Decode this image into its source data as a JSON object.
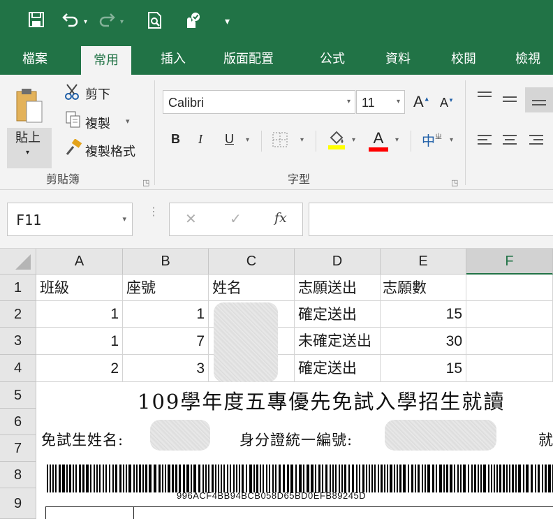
{
  "qat": {
    "save_icon": "save-icon",
    "undo_icon": "undo-icon",
    "redo_icon": "redo-icon",
    "print_preview_icon": "print-preview-icon",
    "touch_mode_icon": "touch-mode-icon",
    "customize_icon": "customize-qat-icon"
  },
  "tabs": [
    {
      "label": "檔案"
    },
    {
      "label": "常用"
    },
    {
      "label": "插入"
    },
    {
      "label": "版面配置"
    },
    {
      "label": "公式"
    },
    {
      "label": "資料"
    },
    {
      "label": "校閱"
    },
    {
      "label": "檢視"
    }
  ],
  "ribbon": {
    "clipboard": {
      "paste_label": "貼上",
      "cut_label": "剪下",
      "copy_label": "複製",
      "format_painter_label": "複製格式",
      "group_label": "剪貼簿"
    },
    "font": {
      "font_name": "Calibri",
      "font_size": "11",
      "bold": "B",
      "italic": "I",
      "underline": "U",
      "font_color_letter": "A",
      "grow_font": "A",
      "shrink_font": "A",
      "phonetic": "中",
      "group_label": "字型"
    }
  },
  "formula_bar": {
    "name_box": "F11",
    "cancel_symbol": "✕",
    "enter_symbol": "✓",
    "fx_symbol": "fx",
    "formula": ""
  },
  "sheet": {
    "columns": [
      "A",
      "B",
      "C",
      "D",
      "E",
      "F"
    ],
    "rows": [
      "1",
      "2",
      "3",
      "4",
      "5",
      "6",
      "7",
      "8",
      "9"
    ],
    "header_row": [
      "班級",
      "座號",
      "姓名",
      "志願送出",
      "志願數"
    ],
    "data_rows": [
      {
        "class": "1",
        "seat": "1",
        "status": "確定送出",
        "count": "15"
      },
      {
        "class": "1",
        "seat": "7",
        "status": "未確定送出",
        "count": "30"
      },
      {
        "class": "2",
        "seat": "3",
        "status": "確定送出",
        "count": "15"
      }
    ]
  },
  "document": {
    "title": "109學年度五專優先免試入學招生就讀",
    "name_label": "免試生姓名:",
    "id_label": "身分證統一編號:",
    "right_label": "就",
    "barcode_text": "996ACF4BB94BCB058D65BD0EFB89245D"
  },
  "colors": {
    "excel_green": "#217346",
    "ribbon_bg": "#f3f3f3",
    "header_bg": "#e6e6e6",
    "fill_yellow": "#ffff00",
    "font_red": "#ff0000"
  }
}
